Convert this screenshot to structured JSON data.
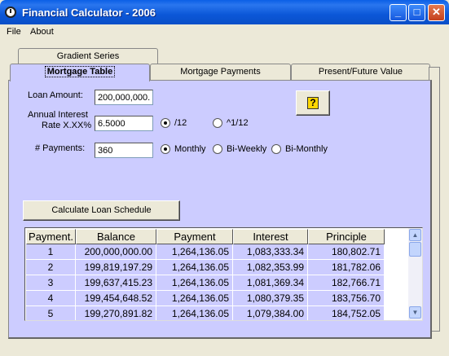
{
  "window": {
    "title": "Financial Calculator - 2006"
  },
  "menu": {
    "items": [
      "File",
      "About"
    ]
  },
  "tabs": {
    "back": [
      {
        "label": "Gradient Series"
      }
    ],
    "front": [
      {
        "label": "Mortgage Table",
        "active": true
      },
      {
        "label": "Mortgage Payments",
        "active": false
      },
      {
        "label": "Present/Future Value",
        "active": false
      }
    ]
  },
  "form": {
    "loan_amount_label": "Loan Amount:",
    "loan_amount_value": "200,000,000.",
    "rate_label_line1": "Annual Interest",
    "rate_label_line2": "Rate X.XX%",
    "rate_value": "6.5000",
    "rate_options": [
      {
        "label": "/12",
        "checked": true
      },
      {
        "label": "^1/12",
        "checked": false
      }
    ],
    "payments_label": "# Payments:",
    "payments_value": "360",
    "frequency_options": [
      {
        "label": "Monthly",
        "checked": true
      },
      {
        "label": "Bi-Weekly",
        "checked": false
      },
      {
        "label": "Bi-Monthly",
        "checked": false
      }
    ],
    "calculate_label": "Calculate Loan Schedule",
    "help_icon_glyph": "?"
  },
  "table": {
    "columns": [
      "Payment.",
      "Balance",
      "Payment",
      "Interest",
      "Principle"
    ],
    "rows": [
      [
        "1",
        "200,000,000.00",
        "1,264,136.05",
        "1,083,333.34",
        "180,802.71"
      ],
      [
        "2",
        "199,819,197.29",
        "1,264,136.05",
        "1,082,353.99",
        "181,782.06"
      ],
      [
        "3",
        "199,637,415.23",
        "1,264,136.05",
        "1,081,369.34",
        "182,766.71"
      ],
      [
        "4",
        "199,454,648.52",
        "1,264,136.05",
        "1,080,379.35",
        "183,756.70"
      ],
      [
        "5",
        "199,270,891.82",
        "1,264,136.05",
        "1,079,384.00",
        "184,752.05"
      ]
    ]
  },
  "colors": {
    "panel": "#ccccff",
    "titlebar": "#0a5fe6",
    "window": "#ece9d8"
  }
}
